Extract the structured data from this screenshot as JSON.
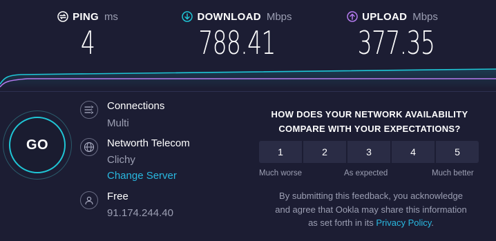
{
  "metrics": {
    "ping": {
      "label": "PING",
      "unit": "ms",
      "value": "4",
      "icon": "ping-icon"
    },
    "download": {
      "label": "DOWNLOAD",
      "unit": "Mbps",
      "value": "788.41",
      "icon": "download-arrow-icon",
      "color": "#1fc6d6"
    },
    "upload": {
      "label": "UPLOAD",
      "unit": "Mbps",
      "value": "377.35",
      "icon": "upload-arrow-icon",
      "color": "#b57bf0"
    }
  },
  "go_button": {
    "label": "GO"
  },
  "connections": {
    "label": "Connections",
    "value": "Multi",
    "icon": "connections-icon"
  },
  "server": {
    "name": "Networth Telecom",
    "location": "Clichy",
    "change_label": "Change Server",
    "icon": "globe-icon"
  },
  "provider": {
    "name": "Free",
    "ip": "91.174.244.40",
    "icon": "user-icon"
  },
  "survey": {
    "question_line1": "HOW DOES YOUR NETWORK AVAILABILITY",
    "question_line2": "COMPARE WITH YOUR EXPECTATIONS?",
    "ratings": [
      "1",
      "2",
      "3",
      "4",
      "5"
    ],
    "scale_low": "Much worse",
    "scale_mid": "As expected",
    "scale_high": "Much better"
  },
  "disclaimer": {
    "line1": "By submitting this feedback, you acknowledge",
    "line2": "and agree that Ookla may share this information",
    "line3_prefix": "as set forth in its",
    "link": "Privacy Policy",
    "line3_suffix": "."
  },
  "colors": {
    "background": "#1c1d33",
    "accent_cyan": "#1fc6d6",
    "accent_purple": "#b57bf0",
    "link": "#29b8e0"
  }
}
